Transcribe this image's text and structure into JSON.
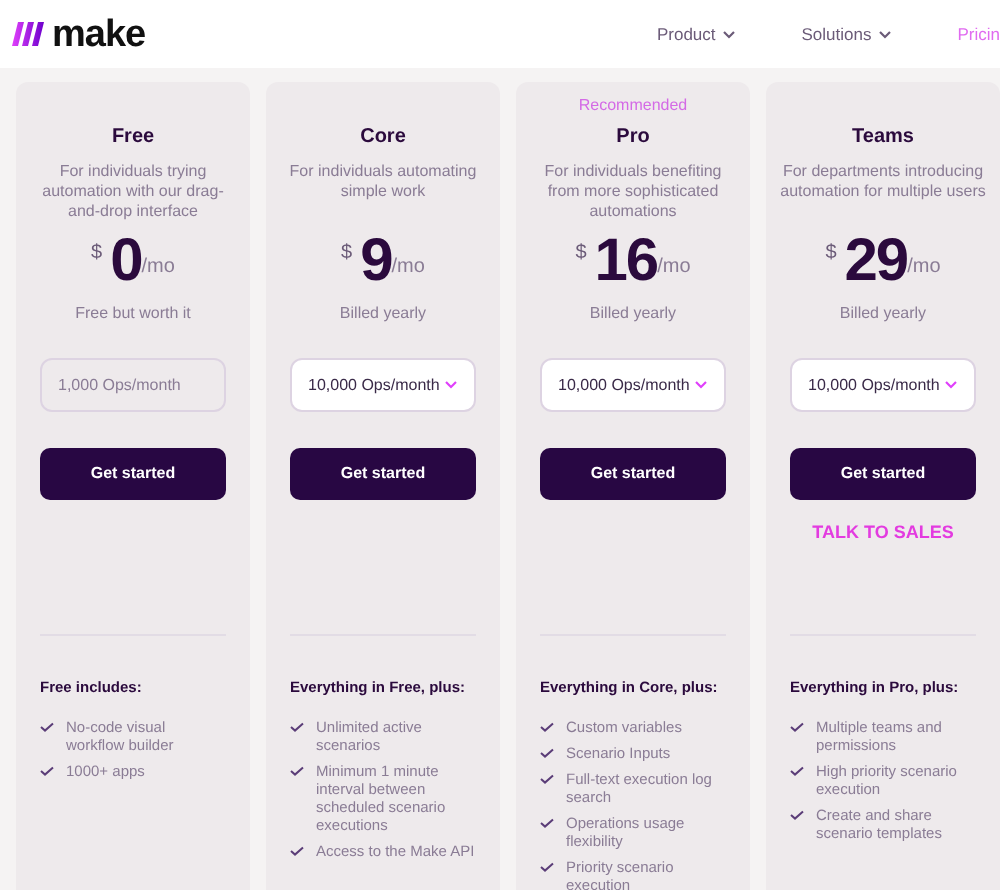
{
  "header": {
    "logo": "make",
    "nav": [
      {
        "label": "Product",
        "dropdown": true,
        "selected": false
      },
      {
        "label": "Solutions",
        "dropdown": true,
        "selected": false
      },
      {
        "label": "Pricin",
        "dropdown": false,
        "selected": true
      }
    ]
  },
  "plans": [
    {
      "name": "Free",
      "description": "For individuals trying automation with our drag-and-drop interface",
      "currency": "$",
      "price": "0",
      "period": "/mo",
      "billing": "Free but worth it",
      "ops": {
        "value": "1,000 Ops/month",
        "disabled": true
      },
      "button": "Get started",
      "includes_title": "Free includes:",
      "features": [
        "No-code visual workflow builder",
        "1000+ apps"
      ]
    },
    {
      "name": "Core",
      "description": "For individuals automating simple work",
      "currency": "$",
      "price": "9",
      "period": "/mo",
      "billing": "Billed yearly",
      "ops": {
        "value": "10,000 Ops/month",
        "disabled": false
      },
      "button": "Get started",
      "includes_title": "Everything in Free, plus:",
      "features": [
        "Unlimited active scenarios",
        "Minimum 1 minute interval between scheduled scenario executions",
        "Access to the Make API"
      ]
    },
    {
      "badge": "Recommended",
      "name": "Pro",
      "description": "For individuals benefiting from more sophisticated automations",
      "currency": "$",
      "price": "16",
      "period": "/mo",
      "billing": "Billed yearly",
      "ops": {
        "value": "10,000 Ops/month",
        "disabled": false
      },
      "button": "Get started",
      "includes_title": "Everything in Core, plus:",
      "features": [
        "Custom variables",
        "Scenario Inputs",
        "Full-text execution log search",
        "Operations usage flexibility",
        "Priority scenario execution"
      ]
    },
    {
      "name": "Teams",
      "description": "For departments introducing automation for multiple users",
      "currency": "$",
      "price": "29",
      "period": "/mo",
      "billing": "Billed yearly",
      "ops": {
        "value": "10,000 Ops/month",
        "disabled": false
      },
      "button": "Get started",
      "link": "TALK TO SALES",
      "includes_title": "Everything in Pro, plus:",
      "features": [
        "Multiple teams and permissions",
        "High priority scenario execution",
        "Create and share scenario templates"
      ]
    }
  ]
}
